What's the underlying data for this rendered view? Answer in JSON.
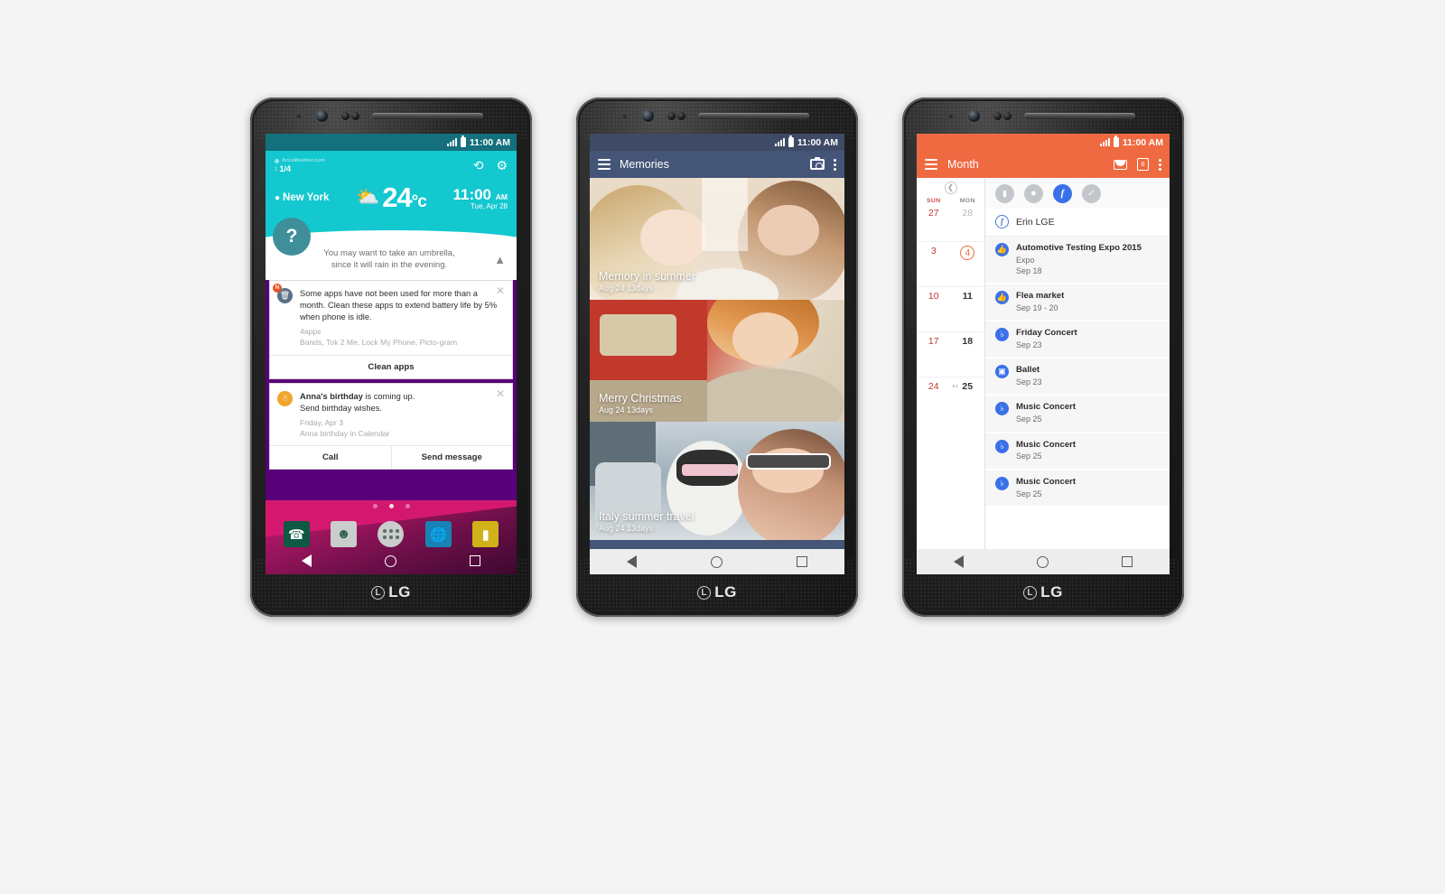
{
  "scene": {
    "background": "#f4f4f4",
    "device_brand": "LG",
    "phones": 3
  },
  "status_bar": {
    "time": "11:00 AM",
    "signal_icon": "signal-bars-icon",
    "battery_icon": "battery-icon"
  },
  "phone1": {
    "screen_name": "home-smart-notice",
    "weather": {
      "source": "AccuWeather.com",
      "page_indicator": "1/4",
      "city": "New York",
      "temperature": "24",
      "unit": "°c",
      "condition_icon": "sun-behind-cloud-icon",
      "time": "11:00",
      "meridiem": "AM",
      "date": "Tue, Apr 28",
      "refresh_icon": "refresh-icon",
      "settings_icon": "gear-icon",
      "accent": "#13c8cf"
    },
    "tip": {
      "badge": "?",
      "line1": "You may want to take an umbrella,",
      "line2": "since it will rain in the evening.",
      "collapse_icon": "chevron-up-icon"
    },
    "cards": [
      {
        "icon": "trash-icon",
        "badge": "N",
        "body": "Some apps have not been used for more than a month. Clean these apps to extend battery life by 5% when phone is idle.",
        "sub1": "4apps",
        "sub2": "Bands, Tok 2 Me, Lock My Phone, Picto-gram",
        "close_icon": "close-icon",
        "actions": [
          "Clean apps"
        ]
      },
      {
        "icon": "birthday-cake-icon",
        "body_bold": "Anna's birthday",
        "body_rest": " is coming up.",
        "body_line2": "Send birthday wishes.",
        "sub1": "Friday, Apr 3",
        "sub2": "Anna birthday in Calendar",
        "close_icon": "close-icon",
        "actions": [
          "Call",
          "Send message"
        ]
      }
    ],
    "home": {
      "page_dots": 3,
      "active_dot": 2,
      "dock": [
        {
          "name": "phone-app-icon",
          "glyph": "✆"
        },
        {
          "name": "contacts-app-icon",
          "glyph": "●"
        },
        {
          "name": "app-drawer-icon",
          "glyph": "grid"
        },
        {
          "name": "browser-app-icon",
          "glyph": "⊕"
        },
        {
          "name": "messaging-app-icon",
          "glyph": "☰"
        }
      ]
    },
    "nav": {
      "back": "back-icon",
      "home": "home-icon",
      "recents": "recents-icon"
    }
  },
  "phone2": {
    "screen_name": "memories-gallery",
    "appbar": {
      "title": "Memories",
      "menu_icon": "hamburger-menu-icon",
      "camera_icon": "camera-icon",
      "overflow_icon": "overflow-menu-icon",
      "accent": "#445577"
    },
    "memories": [
      {
        "title": "Memory in summer",
        "date": "Aug 24 13days",
        "image": "two-women-talking-photo"
      },
      {
        "title": "Merry Christmas",
        "date": "Aug 24 13days",
        "image": "woman-smiling-red-photo"
      },
      {
        "title": "Italy summer travel",
        "date": "Aug 24 13days",
        "image": "woman-and-dog-sunglasses-photo"
      }
    ],
    "nav": {
      "back": "back-icon",
      "home": "home-icon",
      "recents": "recents-icon"
    }
  },
  "phone3": {
    "screen_name": "calendar-month",
    "appbar": {
      "title": "Month",
      "menu_icon": "hamburger-menu-icon",
      "mail_icon": "envelope-icon",
      "date_icon": "calendar-date-icon",
      "date_icon_label": "6",
      "overflow_icon": "overflow-menu-icon",
      "accent": "#ef6a41"
    },
    "calendar": {
      "prev_icon": "chevron-left-icon",
      "weekdays": [
        "SUN",
        "MON"
      ],
      "weeks": [
        {
          "sun": "27",
          "mon": "28",
          "sun_dim": false,
          "mon_dim": true
        },
        {
          "sun": "3",
          "mon": "4",
          "mon_today": true
        },
        {
          "sun": "10",
          "mon": "11"
        },
        {
          "sun": "17",
          "mon": "18"
        },
        {
          "sun": "24",
          "mon": "25",
          "mark": "8.1"
        }
      ]
    },
    "filters": [
      {
        "name": "folder-filter-icon",
        "glyph": "▰",
        "active": false
      },
      {
        "name": "location-filter-icon",
        "glyph": "●",
        "active": false
      },
      {
        "name": "facebook-filter-icon",
        "glyph": "f",
        "active": true
      },
      {
        "name": "check-filter-icon",
        "glyph": "✓",
        "active": false
      }
    ],
    "owner": {
      "icon": "facebook-icon",
      "name": "Erin LGE"
    },
    "events": [
      {
        "icon": "thumbs-up-icon",
        "title": "Automotive Testing Expo 2015",
        "sub": "Expo",
        "date": "Sep 18"
      },
      {
        "icon": "thumbs-up-icon",
        "title": "Flea market",
        "date": "Sep 19 - 20"
      },
      {
        "icon": "concert-icon",
        "title": "Friday Concert",
        "date": "Sep 23"
      },
      {
        "icon": "ticket-icon",
        "title": "Ballet",
        "date": "Sep 23"
      },
      {
        "icon": "concert-icon",
        "title": "Music Concert",
        "date": "Sep 25"
      },
      {
        "icon": "concert-icon",
        "title": "Music Concert",
        "date": "Sep 25"
      },
      {
        "icon": "concert-icon",
        "title": "Music Concert",
        "date": "Sep 25"
      }
    ],
    "nav": {
      "back": "back-icon",
      "home": "home-icon",
      "recents": "recents-icon"
    }
  }
}
